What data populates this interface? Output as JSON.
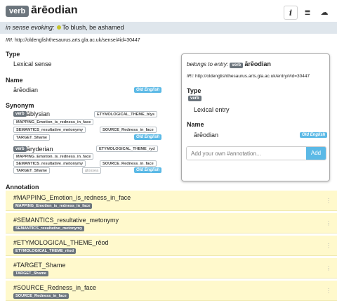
{
  "header": {
    "pos": "verb",
    "title": "ārēodian",
    "tools": {
      "info": "i",
      "list": "≣",
      "cloud": "☁"
    }
  },
  "sense": {
    "label": "in sense evoking:",
    "text": "To blush, be ashamed",
    "dot_color": "#c5c22a"
  },
  "iri": {
    "label": "IRI:",
    "url": "http://oldenglishthesaurus.arts.gla.ac.uk/sense/#id=30447"
  },
  "type": {
    "heading": "Type",
    "value": "Lexical sense"
  },
  "name": {
    "heading": "Name",
    "value": "ārēodian",
    "lang": "Old English"
  },
  "synonym": {
    "heading": "Synonym",
    "items": [
      {
        "pos": "verb",
        "word": "āblysian",
        "chips": [
          "ETYMOLOGICAL_THEME_blys",
          "MAPPING_Emotion_is_redness_in_face",
          "SEMANTICS_resultative_metonymy",
          "SOURCE_Redness_in_face",
          "TARGET_Shame"
        ],
        "lang": "Old English"
      },
      {
        "pos": "verb",
        "word": "āryderian",
        "chips": [
          "ETYMOLOGICAL_THEME_ryd",
          "MAPPING_Emotion_is_redness_in_face",
          "SEMANTICS_resultative_metonymy",
          "SOURCE_Redness_in_face",
          "TARGET_Shame",
          "glossea"
        ],
        "lang": "Old English"
      }
    ]
  },
  "entry": {
    "label": "belongs to entry:",
    "pos": "verb",
    "word": "ārēodian",
    "iri_label": "IRI:",
    "iri_url": "http://oldenglishthesaurus.arts.gla.ac.uk/entry/#id=30447",
    "type_heading": "Type",
    "type_pos": "verb",
    "type_value": "Lexical entry",
    "name_heading": "Name",
    "name_value": "ārēodian",
    "name_lang": "Old English",
    "input_placeholder": "Add your own #annotation...",
    "add_label": "Add"
  },
  "annotation": {
    "heading": "Annotation",
    "items": [
      {
        "name": "#MAPPING_Emotion_is_redness_in_face",
        "code": "MAPPING_Emotion_is_redness_in_face"
      },
      {
        "name": "#SEMANTICS_resultative_metonymy",
        "code": "SEMANTICS_resultative_metonymy"
      },
      {
        "name": "#ETYMOLOGICAL_THEME_rēod",
        "code": "ETYMOLOGICAL_THEME_rēod"
      },
      {
        "name": "#TARGET_Shame",
        "code": "TARGET_Shame"
      },
      {
        "name": "#SOURCE_Redness_in_face",
        "code": "SOURCE_Redness_in_face"
      }
    ],
    "menu_icon": "⋮"
  }
}
